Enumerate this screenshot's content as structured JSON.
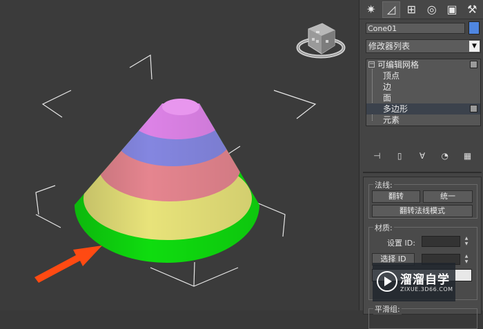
{
  "command_panel": {
    "tabs": [
      {
        "icon": "create-icon",
        "active": false
      },
      {
        "icon": "modify-icon",
        "active": true
      },
      {
        "icon": "hierarchy-icon",
        "active": false
      },
      {
        "icon": "motion-icon",
        "active": false
      },
      {
        "icon": "display-icon",
        "active": false
      },
      {
        "icon": "utilities-icon",
        "active": false
      }
    ],
    "object_name": "Cone01",
    "object_color": "#4f86e0",
    "modifier_list": "修改器列表",
    "stack": {
      "root": "可编辑网格",
      "items": [
        "顶点",
        "边",
        "面",
        "多边形",
        "元素"
      ],
      "selected": "多边形"
    },
    "stack_tools": [
      "pin-stack-icon",
      "show-end-result-icon",
      "make-unique-icon",
      "remove-modifier-icon",
      "configure-sets-icon"
    ],
    "surface_properties": {
      "normals_group": "法线:",
      "flip_label": "翻转",
      "unify_label": "统一",
      "flip_normal_mode_label": "翻转法线模式",
      "material_group": "材质:",
      "set_id_label": "设置 ID:",
      "select_id_label": "选择 ID",
      "smoothing_group": "平滑组:"
    }
  },
  "viewport": {
    "cone_band_colors": [
      "#0fdc0f",
      "#e8e37a",
      "#e5858f",
      "#8486e0",
      "#dc82e6"
    ],
    "arrow_color": "#ff4a12"
  },
  "watermark": {
    "name": "溜溜自学",
    "url": "ZIXUE.3D66.COM"
  }
}
